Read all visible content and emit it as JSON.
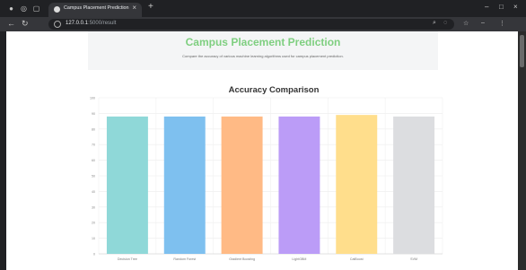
{
  "browser": {
    "tab_title": "Campus Placement Prediction",
    "url_host": "127.0.0.1",
    "url_rest": ":5000/result",
    "colors": {
      "frame": "#202124",
      "toolbar": "#35363a"
    }
  },
  "page": {
    "title": "Campus Placement Prediction",
    "subtitle": "Compare the accuracy of various machine learning algorithms used for campus placement prediction."
  },
  "chart_data": {
    "type": "bar",
    "title": "Accuracy Comparison",
    "categories": [
      "Decision Tree",
      "Random Forest",
      "Gradient Boosting",
      "LightGBM",
      "CatBoost",
      "SVM"
    ],
    "values": [
      88,
      88,
      88,
      88,
      89,
      88
    ],
    "colors": [
      "#8fd8d8",
      "#7ec0ef",
      "#ffba85",
      "#bb9cf7",
      "#ffde8c",
      "#dcdde0"
    ],
    "ylim": [
      0,
      100
    ],
    "yticks": [
      0,
      10,
      20,
      30,
      40,
      50,
      60,
      70,
      80,
      90,
      100
    ],
    "grid": true,
    "xlabel": "",
    "ylabel": ""
  }
}
